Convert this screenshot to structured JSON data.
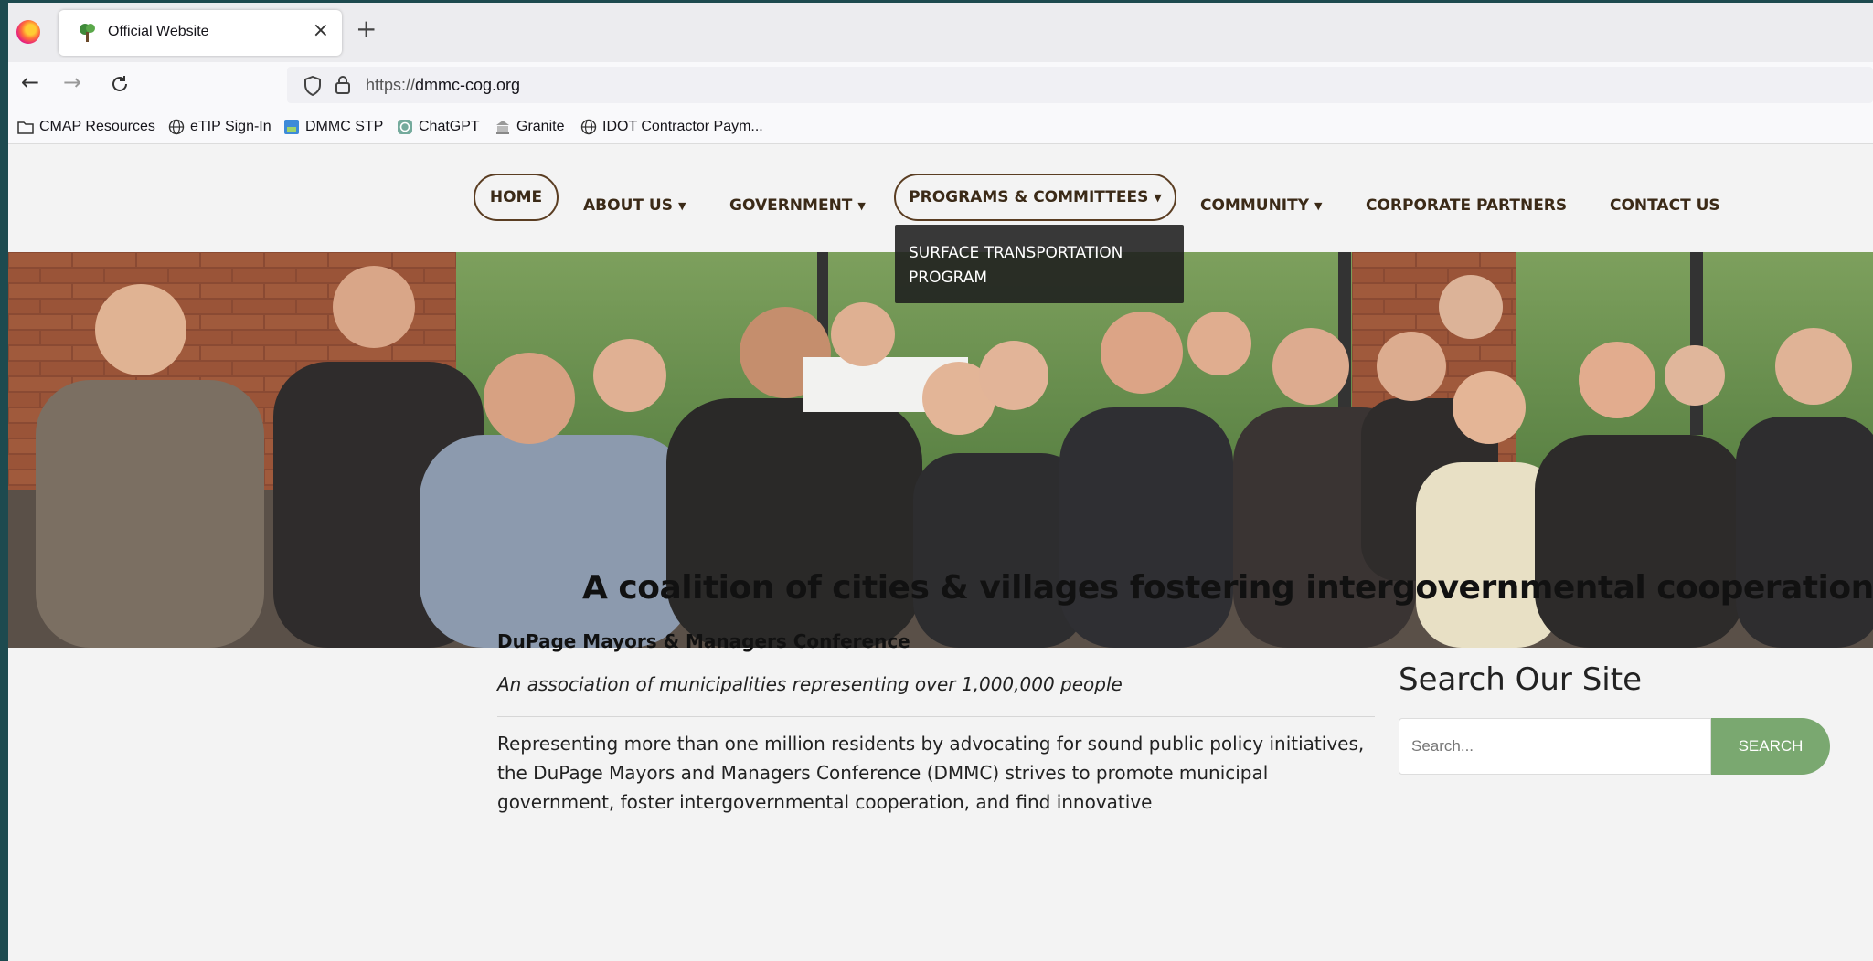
{
  "browser": {
    "tab_title": "Official Website",
    "tab_close": "×",
    "new_tab": "+",
    "url_prefix": "https://",
    "url_domain": "dmmc-cog.org",
    "bookmarks": [
      {
        "label": "CMAP Resources",
        "icon": "folder-icon"
      },
      {
        "label": "eTIP Sign-In",
        "icon": "globe-icon"
      },
      {
        "label": "DMMC STP",
        "icon": "site-icon"
      },
      {
        "label": "ChatGPT",
        "icon": "chatgpt-icon"
      },
      {
        "label": "Granite",
        "icon": "granite-icon"
      },
      {
        "label": "IDOT Contractor Paym...",
        "icon": "globe-icon"
      }
    ]
  },
  "nav": {
    "home": "HOME",
    "about": "ABOUT US",
    "government": "GOVERNMENT",
    "programs": "PROGRAMS & COMMITTEES",
    "community": "COMMUNITY",
    "partners": "CORPORATE PARTNERS",
    "contact": "CONTACT US",
    "caret": "▼",
    "dropdown_item": "SURFACE TRANSPORTATION PROGRAM"
  },
  "main": {
    "headline": "A coalition of cities & villages fostering intergovernmental cooperation",
    "org_name": "DuPage Mayors & Managers Conference",
    "tagline": "An association of municipalities representing over 1,000,000 people",
    "body": "Representing more than one million residents by advocating for sound public policy initiatives, the DuPage Mayors and Managers Conference (DMMC) strives to promote municipal government, foster intergovernmental cooperation, and find innovative"
  },
  "sidebar": {
    "search_title": "Search Our Site",
    "search_placeholder": "Search...",
    "search_button": "SEARCH"
  },
  "colors": {
    "accent_green": "#7aa870",
    "nav_brown": "#3b2a17",
    "desktop_teal": "#1d4a4f"
  }
}
